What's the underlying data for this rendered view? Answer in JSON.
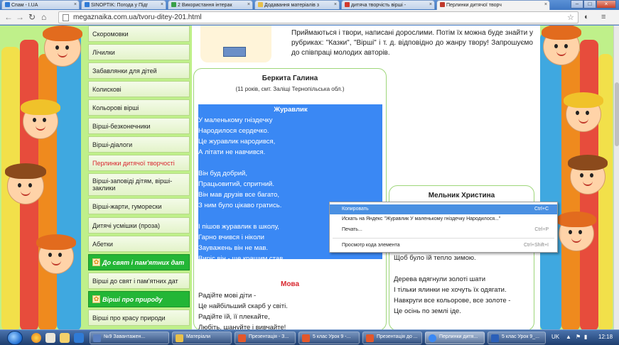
{
  "browser": {
    "tabs": [
      {
        "label": "Спам - I.UA",
        "icon_color": "#2f7bd6"
      },
      {
        "label": "SINOPTIK: Погода у Підг",
        "icon_color": "#2f7bd6"
      },
      {
        "label": "2 Використання інтерак",
        "icon_color": "#3aa04a"
      },
      {
        "label": "Додавання матеріалів з",
        "icon_color": "#e8c04a"
      },
      {
        "label": "дитяча творчість вірші -",
        "icon_color": "#d23a2e"
      },
      {
        "label": "Перлинки дитячої творч",
        "icon_color": "#c0392b"
      }
    ],
    "url": "megaznaika.com.ua/tvoru-ditey-201.html"
  },
  "menu": {
    "items": [
      {
        "label": "Скоромовки",
        "kind": "normal"
      },
      {
        "label": "Лічилки",
        "kind": "normal"
      },
      {
        "label": "Забавлянки для дітей",
        "kind": "normal"
      },
      {
        "label": "Колискові",
        "kind": "normal"
      },
      {
        "label": "Кольорові вірші",
        "kind": "normal"
      },
      {
        "label": "Вірші-безконечники",
        "kind": "normal"
      },
      {
        "label": "Вірші-діалоги",
        "kind": "normal"
      },
      {
        "label": "Перлинки дитячої творчості",
        "kind": "active"
      },
      {
        "label": "Вірші-заповіді дітям, вірші-заклики",
        "kind": "normal"
      },
      {
        "label": "Вірші-жарти, гуморески",
        "kind": "normal"
      },
      {
        "label": "Дитячі усмішки (проза)",
        "kind": "normal"
      },
      {
        "label": "Абетки",
        "kind": "normal"
      },
      {
        "label": "До свят і пам'ятних дат",
        "kind": "category"
      },
      {
        "label": "Вірші до свят і пам'ятних дат",
        "kind": "normal"
      },
      {
        "label": "Вірші про природу",
        "kind": "category"
      },
      {
        "label": "Вірші про красу природи",
        "kind": "normal"
      }
    ]
  },
  "intro": {
    "text": "Приймаються і твори, написані дорослими. Потім їх можна буде знайти у рубриках: \"Казки\", \"Вірші\" і т. д. відповідно до жанру твору! Запрошуємо до співпраці молодих авторів."
  },
  "card1": {
    "author": "Беркита Галина",
    "author_sub": "(11 років, смт. Заліщі Тернопільська обл.)",
    "poem_title": "Журавлик",
    "poem_lines": [
      "У маленькому гніздечку",
      "Народилося сердечко.",
      "Це журавлик народився,",
      "А літати не навчився.",
      "",
      "Він буд добрий,",
      "Працьовитий, спритний.",
      "Він мав друзів все багато,",
      "З ним було цікаво гратись.",
      "",
      "І пішов журавлик в школу,",
      "Гарно вчився і ніколи",
      "Зауважень він не мав.",
      "Виріс він - ще кращим став."
    ],
    "poem2_title": "Мова",
    "poem2_lines": [
      "Радійте мові діти -",
      "Це найбільший скарб у світі.",
      "Радійте їй, її плекайте,",
      "Любіть, шануйте і вивчайте!"
    ]
  },
  "card2": {
    "author": "Мельник Христина",
    "lines": [
      "Щоб було їй тепло зимою.",
      "",
      "Дерева вдягнули золоті шати",
      "І тільки ялинки не хочуть їх одягати.",
      "Навкруги все кольорове, все золоте -",
      "Це осінь по землі іде."
    ]
  },
  "context_menu": {
    "items": [
      {
        "label": "Копировать",
        "shortcut": "Ctrl+C",
        "hover": true
      },
      {
        "label": "Искать на Яндекс \"Журавлик У маленькому гніздечку Народилося...\"",
        "shortcut": "",
        "hover": false
      },
      {
        "label": "Печать...",
        "shortcut": "Ctrl+P",
        "hover": false
      },
      {
        "label": "Просмотр кода элемента",
        "shortcut": "Ctrl+Shift+I",
        "hover": false
      }
    ]
  },
  "taskbar": {
    "tasks": [
      {
        "label": "№9 Завантажен...",
        "icon_color": "#5a7fc0"
      },
      {
        "label": "Матеріали",
        "icon_color": "#e8c04a"
      },
      {
        "label": "Презентація - З...",
        "icon_color": "#e2572b"
      },
      {
        "label": "5 клас Урок 9 -...",
        "icon_color": "#e2572b"
      },
      {
        "label": "Презентація до ...",
        "icon_color": "#e2572b"
      },
      {
        "label": "Перлинки дитя...",
        "icon_color": "#3a88f4"
      },
      {
        "label": "5 клас Урок 9_...",
        "icon_color": "#2b5fb8"
      }
    ],
    "lang": "UK",
    "time": "12:18"
  }
}
